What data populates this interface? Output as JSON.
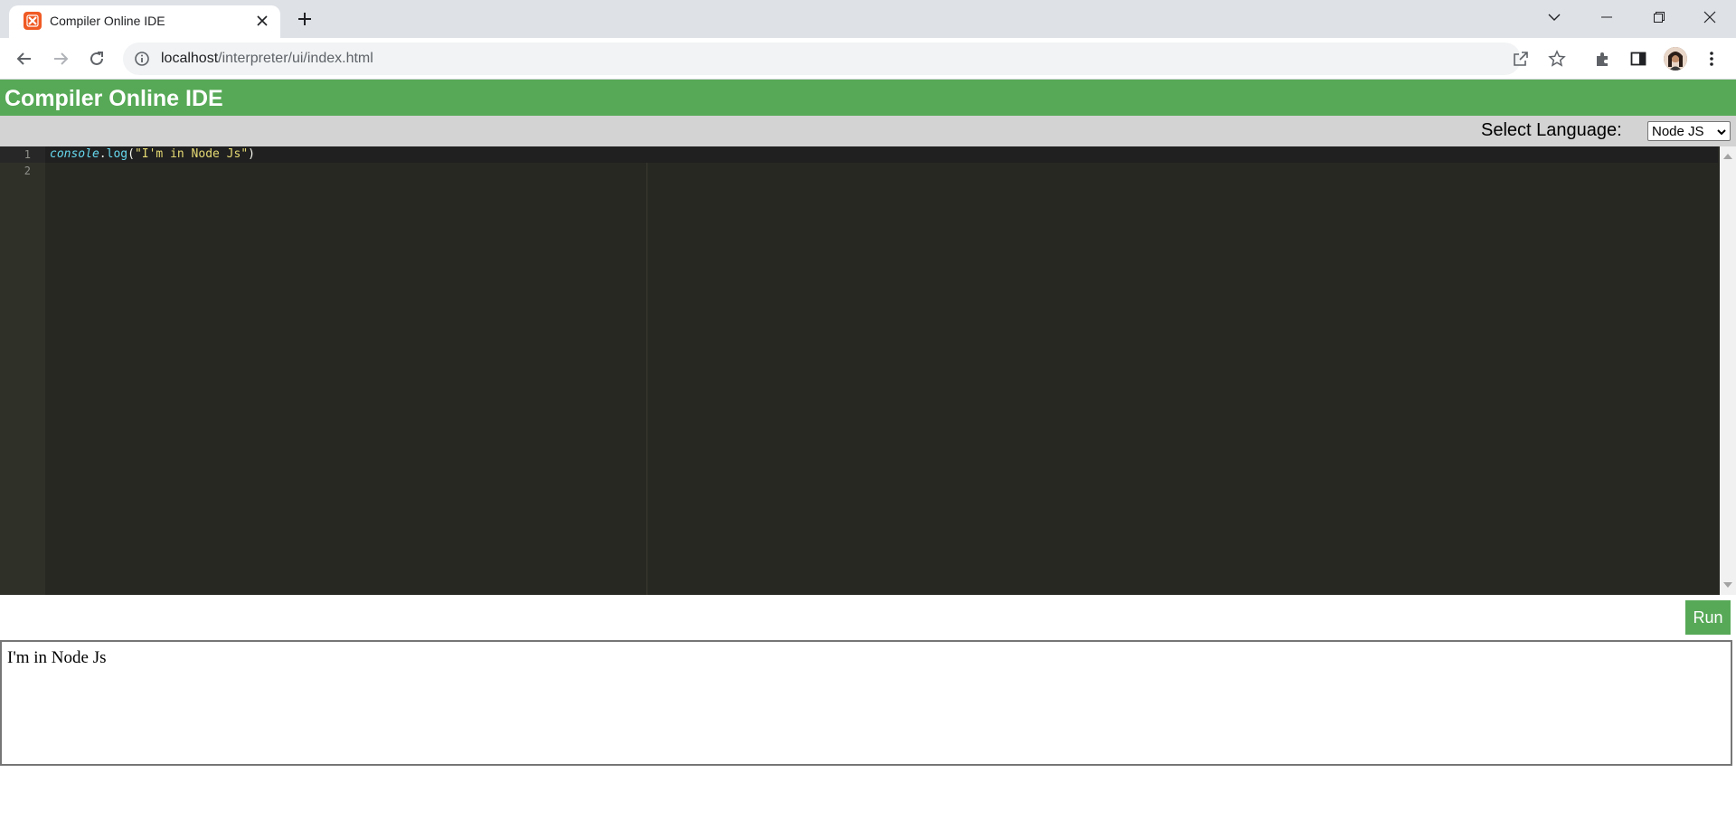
{
  "browser": {
    "tab_title": "Compiler Online IDE",
    "url_host": "localhost",
    "url_path": "/interpreter/ui/index.html",
    "icons": [
      "xampp-favicon",
      "close-icon",
      "plus-icon",
      "chevron-down-icon",
      "minimize-icon",
      "restore-icon",
      "close-window-icon",
      "back-arrow-icon",
      "forward-arrow-icon",
      "reload-icon",
      "info-icon",
      "share-icon",
      "star-icon",
      "puzzle-icon",
      "side-panel-icon",
      "kebab-menu-icon"
    ]
  },
  "page": {
    "title": "Compiler Online IDE",
    "language_label": "Select Language:",
    "language_selected": "Node JS",
    "run_label": "Run",
    "accent_color": "#57a957"
  },
  "editor": {
    "line_numbers": [
      "1",
      "2"
    ],
    "code": {
      "object": "console",
      "dot": ".",
      "method": "log",
      "open_paren": "(",
      "string": "\"I'm in Node Js\"",
      "close_paren": ")"
    },
    "theme_bg": "#272822"
  },
  "output": {
    "text": "I'm in Node Js"
  }
}
